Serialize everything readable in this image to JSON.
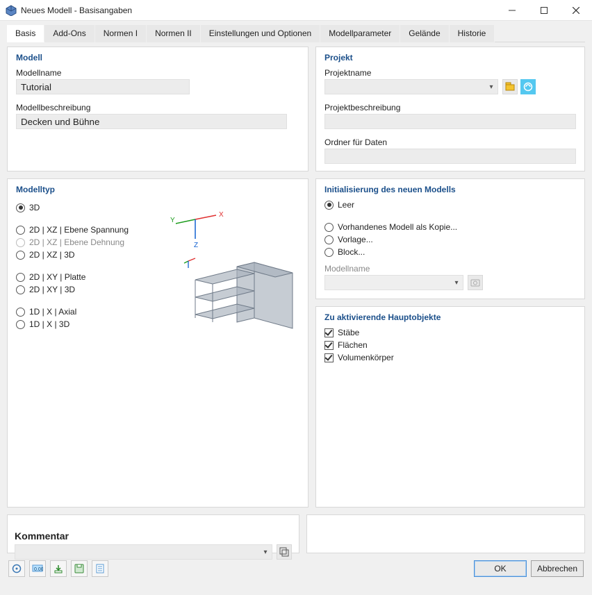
{
  "window": {
    "title": "Neues Modell - Basisangaben"
  },
  "tabs": {
    "basis": "Basis",
    "addons": "Add-Ons",
    "normen1": "Normen I",
    "normen2": "Normen II",
    "einstellungen": "Einstellungen und Optionen",
    "modellparameter": "Modellparameter",
    "gelaende": "Gelände",
    "historie": "Historie"
  },
  "modell": {
    "heading": "Modell",
    "name_label": "Modellname",
    "name_value": "Tutorial",
    "desc_label": "Modellbeschreibung",
    "desc_value": "Decken und Bühne"
  },
  "projekt": {
    "heading": "Projekt",
    "name_label": "Projektname",
    "name_value": "",
    "desc_label": "Projektbeschreibung",
    "desc_value": "",
    "folder_label": "Ordner für Daten",
    "folder_value": ""
  },
  "modelltyp": {
    "heading": "Modelltyp",
    "o_3d": "3D",
    "o_2dxz_span": "2D | XZ | Ebene Spannung",
    "o_2dxz_dehn": "2D | XZ | Ebene Dehnung",
    "o_2dxz_3d": "2D | XZ | 3D",
    "o_2dxy_platte": "2D | XY | Platte",
    "o_2dxy_3d": "2D | XY | 3D",
    "o_1dx_axial": "1D | X | Axial",
    "o_1dx_3d": "1D | X | 3D",
    "selected": "3D"
  },
  "init": {
    "heading": "Initialisierung des neuen Modells",
    "o_leer": "Leer",
    "o_kopie": "Vorhandenes Modell als Kopie...",
    "o_vorlage": "Vorlage...",
    "o_block": "Block...",
    "modellname_label": "Modellname",
    "modellname_value": "",
    "selected": "Leer"
  },
  "hauptobj": {
    "heading": "Zu aktivierende Hauptobjekte",
    "staebe": "Stäbe",
    "flaechen": "Flächen",
    "volumen": "Volumenkörper"
  },
  "kommentar": {
    "heading": "Kommentar",
    "value": ""
  },
  "footer": {
    "ok": "OK",
    "cancel": "Abbrechen"
  }
}
